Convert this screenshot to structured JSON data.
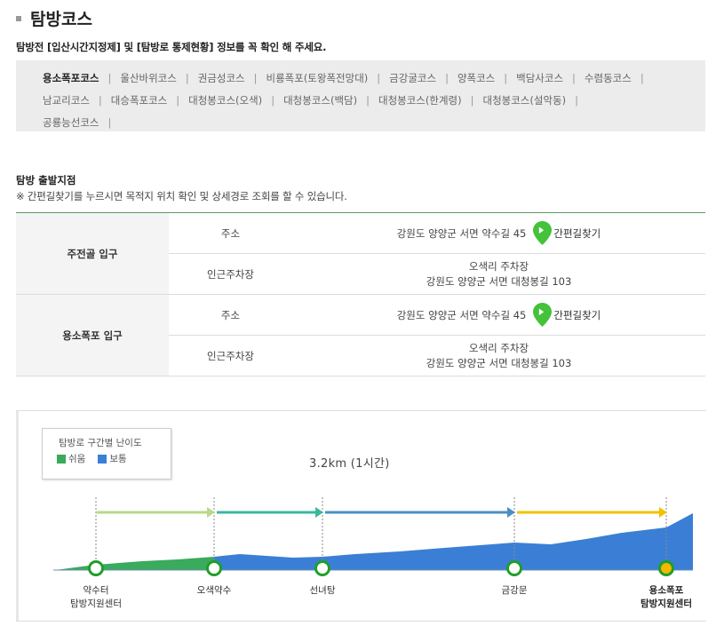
{
  "page": {
    "title": "탐방코스"
  },
  "notice": "탐방전 [입산시간지정제] 및 [탐방로 통제현황] 정보를 꼭 확인 해 주세요.",
  "courses": {
    "rows": [
      [
        "용소폭포코스",
        "울산바위코스",
        "권금성코스",
        "비룡폭포(토왕폭전망대)",
        "금강굴코스",
        "양폭코스",
        "백담사코스",
        "수렴동코스"
      ],
      [
        "남교리코스",
        "대승폭포코스",
        "대청봉코스(오색)",
        "대청봉코스(백담)",
        "대청봉코스(한계령)",
        "대청봉코스(설악동)"
      ],
      [
        "공룡능선코스"
      ]
    ],
    "active": "용소폭포코스",
    "separator": "|"
  },
  "start_points": {
    "title": "탐방 출발지점",
    "note": "※ 간편길찾기를 누르시면 목적지 위치 확인 및 상세경로 조회를 할 수 있습니다.",
    "entries": [
      {
        "name": "주전골 입구",
        "address_label": "주소",
        "address": "강원도 양양군 서면 약수길 45",
        "nav_label": "간편길찾기",
        "parking_label": "인근주차장",
        "parking_name": "오색리 주차장",
        "parking_address": "강원도 양양군 서면 대청봉길 103"
      },
      {
        "name": "용소폭포 입구",
        "address_label": "주소",
        "address": "강원도 양양군 서면 약수길 45",
        "nav_label": "간편길찾기",
        "parking_label": "인근주차장",
        "parking_name": "오색리 주차장",
        "parking_address": "강원도 양양군 서면 대청봉길 103"
      }
    ]
  },
  "legend": {
    "title": "탐방로 구간별 난이도",
    "items": [
      {
        "label": "쉬움",
        "color": "#3aaa5c"
      },
      {
        "label": "보통",
        "color": "#3a7fd5"
      }
    ]
  },
  "chart_data": {
    "type": "area",
    "distance_label": "3.2km (1시간)",
    "stops": [
      {
        "name": [
          "약수터",
          "탐방지원센터"
        ],
        "bold": false
      },
      {
        "name": [
          "오색약수"
        ],
        "bold": false
      },
      {
        "name": [
          "선녀탕"
        ],
        "bold": false
      },
      {
        "name": [
          "금강문"
        ],
        "bold": false
      },
      {
        "name": [
          "용소폭포",
          "탐방지원센터"
        ],
        "bold": true
      }
    ],
    "segment_arrow_colors": [
      "#b8d98a",
      "#3bb89c",
      "#4a8fc4",
      "#f2c100"
    ],
    "difficulty_sequence": [
      "쉬움",
      "보통",
      "보통",
      "보통"
    ],
    "colors": {
      "easy": "#3aaa5c",
      "normal": "#3a7fd5",
      "pin": "#43c23a",
      "stop_ring": "#1f9e2b",
      "end_fill": "#f2b800"
    }
  }
}
